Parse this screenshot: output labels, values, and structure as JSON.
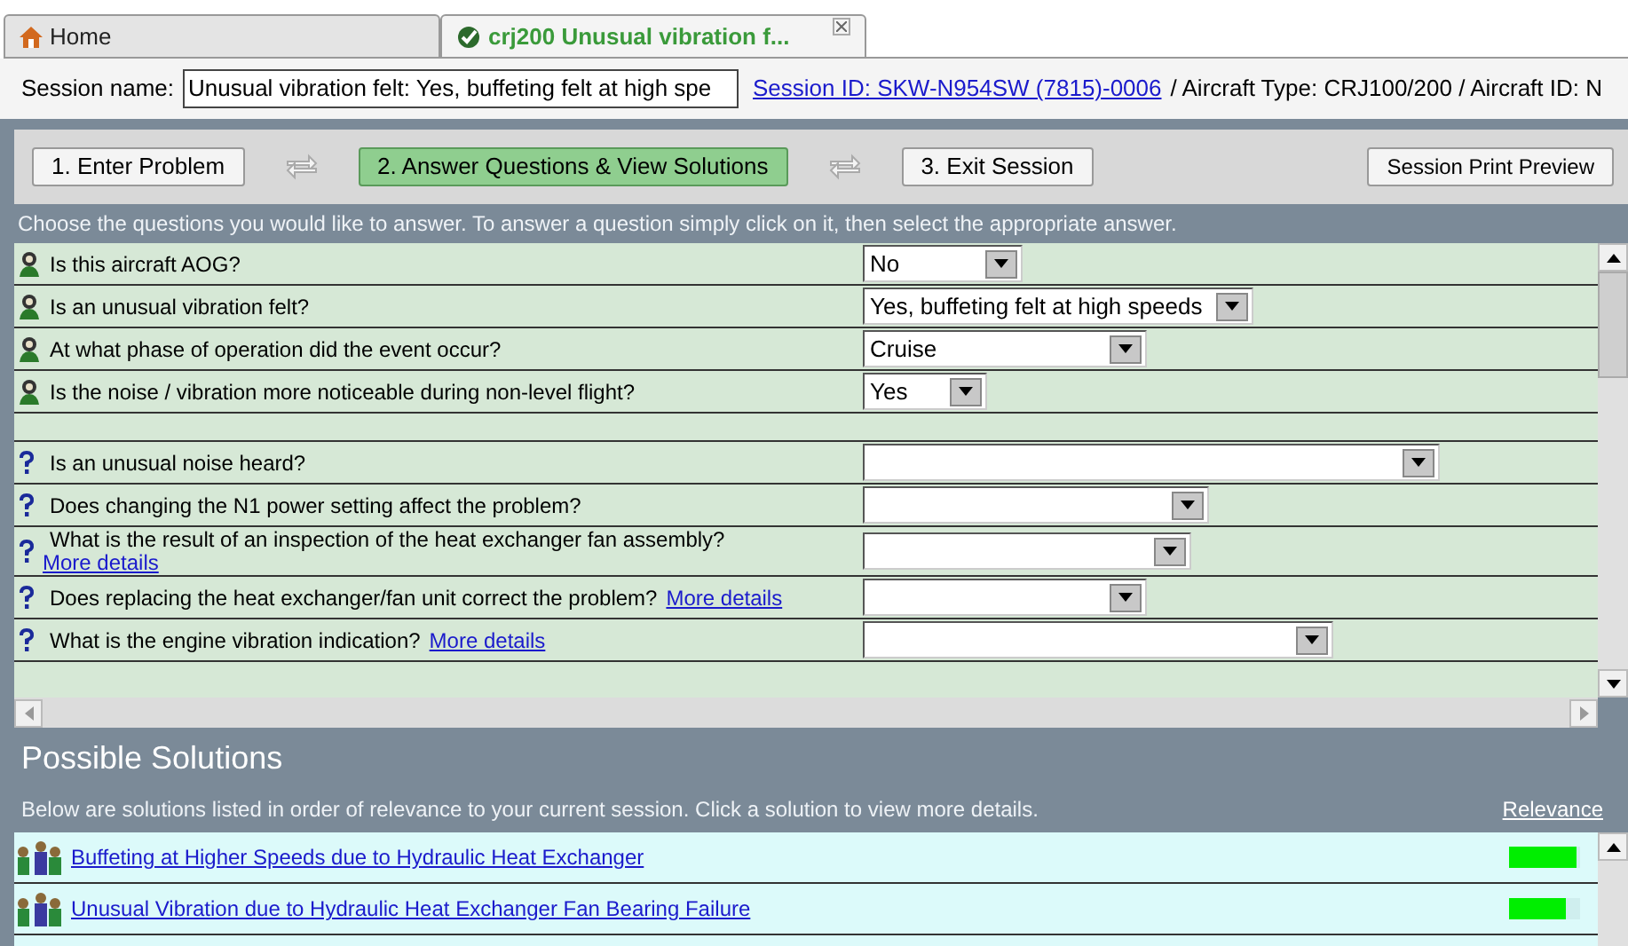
{
  "tabs": [
    {
      "kind": "home",
      "label": "Home",
      "selected": false
    },
    {
      "kind": "session",
      "label": "crj200 Unusual vibration f...",
      "selected": true,
      "closable": true
    }
  ],
  "session": {
    "label": "Session name:",
    "value": "Unusual vibration felt: Yes, buffeting felt at high spe",
    "link": "Session ID: SKW-N954SW (7815)-0006",
    "info": "/ Aircraft Type: CRJ100/200 / Aircraft ID: N"
  },
  "steps": [
    {
      "label": "1. Enter Problem",
      "selected": false
    },
    {
      "label": "2. Answer Questions & View Solutions",
      "selected": true
    },
    {
      "label": "3. Exit Session",
      "selected": false
    }
  ],
  "print_button": "Session Print Preview",
  "instructions": "Choose the questions you would like to answer. To answer a question simply click on it, then select the appropriate answer.",
  "questions": [
    {
      "kind": "answered",
      "text": "Is this aircraft AOG?",
      "answer": "No"
    },
    {
      "kind": "answered",
      "text": "Is an unusual vibration felt?",
      "answer": "Yes, buffeting felt at high speeds"
    },
    {
      "kind": "answered",
      "text": "At what phase of operation did the event occur?",
      "answer": "Cruise"
    },
    {
      "kind": "answered",
      "text": "Is the noise / vibration more noticeable during non-level flight?",
      "answer": "Yes"
    },
    {
      "kind": "spacer"
    },
    {
      "kind": "open",
      "text": "Is an unusual noise heard?"
    },
    {
      "kind": "open",
      "text": "Does changing the N1 power setting affect the problem?"
    },
    {
      "kind": "open",
      "text": "What is the result of an inspection of the heat exchanger fan assembly?",
      "link": "More details",
      "link_below": true
    },
    {
      "kind": "open",
      "text": "Does replacing the heat exchanger/fan unit correct the problem?",
      "link": "More details"
    },
    {
      "kind": "open",
      "text": "What is the engine vibration indication?",
      "link": "More details"
    }
  ],
  "solutions": {
    "title": "Possible Solutions",
    "description": "Below are solutions listed in order of relevance to your current session. Click a solution to view more details.",
    "relevance_link": "Relevance",
    "items": [
      {
        "title": "Buffeting at Higher Speeds due to Hydraulic Heat Exchanger",
        "level": 0.95
      },
      {
        "title": "Unusual Vibration due to Hydraulic Heat Exchanger Fan Bearing Failure",
        "level": 0.8
      }
    ]
  }
}
